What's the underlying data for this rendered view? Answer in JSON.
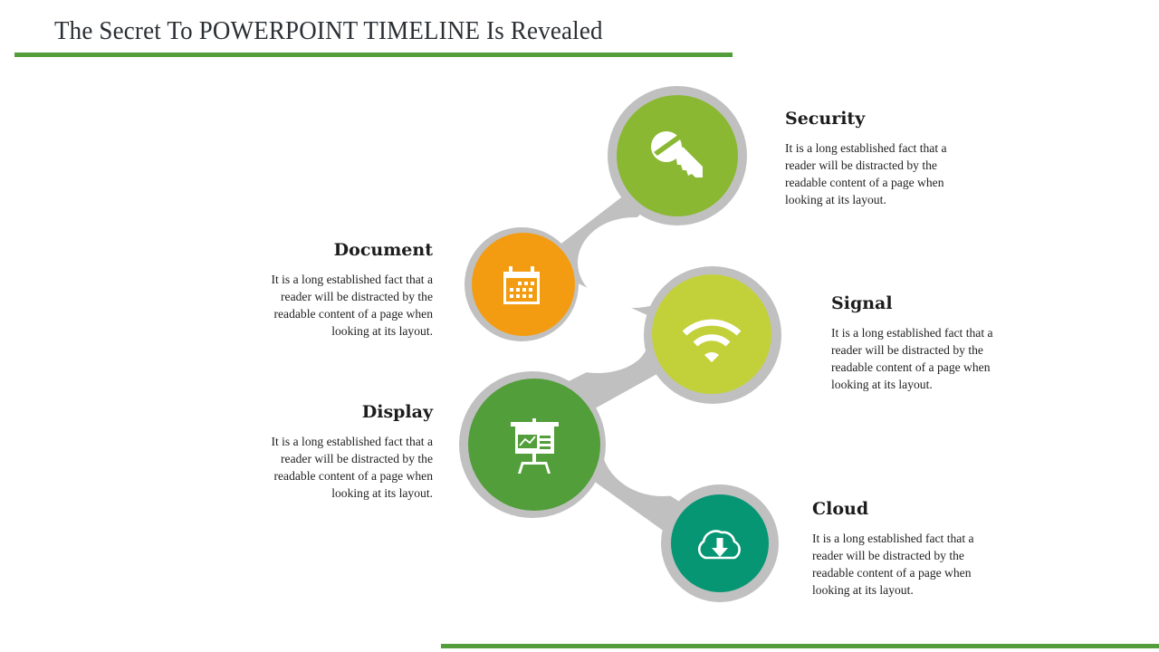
{
  "title": "The Secret To POWERPOINT TIMELINE Is Revealed",
  "colors": {
    "accent_rule": "#539E3A",
    "ring": "#C0C0C0",
    "security": "#8BB833",
    "document": "#F39C12",
    "signal": "#C2D13A",
    "display": "#529E3A",
    "cloud": "#069673",
    "icon": "#FFFFFF"
  },
  "items": [
    {
      "id": "security",
      "heading": "Security",
      "icon": "key-icon",
      "text": "It is a long established fact that a reader will be distracted by the readable content of a page when looking at its layout.",
      "lines": [
        "It is a long established fact that a",
        "reader will be distracted by the",
        "readable content of a page when",
        "looking at its layout."
      ]
    },
    {
      "id": "document",
      "heading": "Document",
      "icon": "calendar-icon",
      "text": "It is a long established fact that a reader will be distracted by the readable content of a page when looking at its layout.",
      "lines": [
        "It is a long established fact that a",
        "reader will be distracted by the",
        "readable content of a page when",
        "looking at its layout."
      ]
    },
    {
      "id": "signal",
      "heading": "Signal",
      "icon": "wifi-icon",
      "text": "It is a long established fact that a reader will be distracted by the readable content of a page when looking at its layout.",
      "lines": [
        "It is a long established fact that a",
        "reader will be distracted by the",
        "readable content of a page when",
        "looking at its layout."
      ]
    },
    {
      "id": "display",
      "heading": "Display",
      "icon": "presentation-board-icon",
      "text": "It is a long established fact that a reader will be distracted by the readable content of a page when looking at its layout.",
      "lines": [
        "It is a long established fact that a",
        "reader will be distracted by the",
        "readable content of a page when",
        "looking at its layout."
      ]
    },
    {
      "id": "cloud",
      "heading": "Cloud",
      "icon": "cloud-download-icon",
      "text": "It is a long established fact that a reader will be distracted by the readable content of a page when looking at its layout.",
      "lines": [
        "It is a long established fact that a",
        "reader will be distracted by the",
        "readable content of a page when",
        "looking at its layout."
      ]
    }
  ]
}
